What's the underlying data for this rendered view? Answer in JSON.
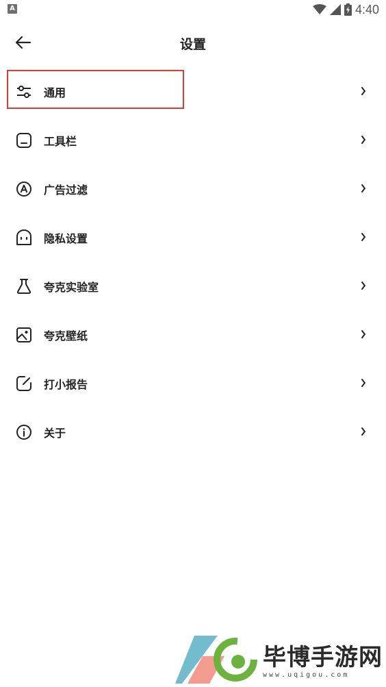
{
  "status_bar": {
    "app_icon_letter": "A",
    "time": "4:40"
  },
  "header": {
    "title": "设置"
  },
  "menu": {
    "items": [
      {
        "label": "通用",
        "icon": "sliders-icon"
      },
      {
        "label": "工具栏",
        "icon": "toolbar-icon"
      },
      {
        "label": "广告过滤",
        "icon": "ad-filter-icon"
      },
      {
        "label": "隐私设置",
        "icon": "privacy-icon"
      },
      {
        "label": "夸克实验室",
        "icon": "flask-icon"
      },
      {
        "label": "夸克壁纸",
        "icon": "image-icon"
      },
      {
        "label": "打小报告",
        "icon": "edit-report-icon"
      },
      {
        "label": "关于",
        "icon": "info-icon"
      }
    ]
  },
  "watermark": {
    "brand": "毕博手游网",
    "url": "www.uqigou.com"
  },
  "colors": {
    "highlight": "#e53935",
    "text": "#222222",
    "logo_green": "#6cb33e",
    "logo_teal": "#5ab0c4",
    "logo_red": "#f08a7a"
  }
}
